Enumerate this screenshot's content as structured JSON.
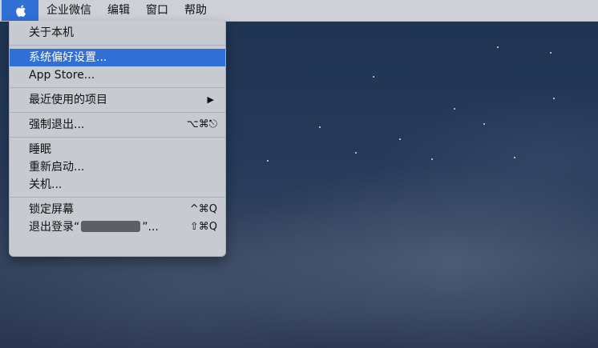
{
  "menubar": {
    "apple_icon": "apple-logo-icon",
    "items": [
      "企业微信",
      "编辑",
      "窗口",
      "帮助"
    ],
    "accent": "#2f6fd6"
  },
  "apple_menu": {
    "about": "关于本机",
    "system_prefs": "系统偏好设置...",
    "app_store": "App Store...",
    "recent_items": "最近使用的项目",
    "force_quit": "强制退出...",
    "force_quit_shortcut": "⌥⌘⎋",
    "sleep": "睡眠",
    "restart": "重新启动...",
    "shutdown": "关机...",
    "lock_screen": "锁定屏幕",
    "lock_shortcut": "^⌘Q",
    "logout_prefix": "退出登录“",
    "logout_suffix": "”...",
    "logout_shortcut": "⇧⌘Q"
  }
}
